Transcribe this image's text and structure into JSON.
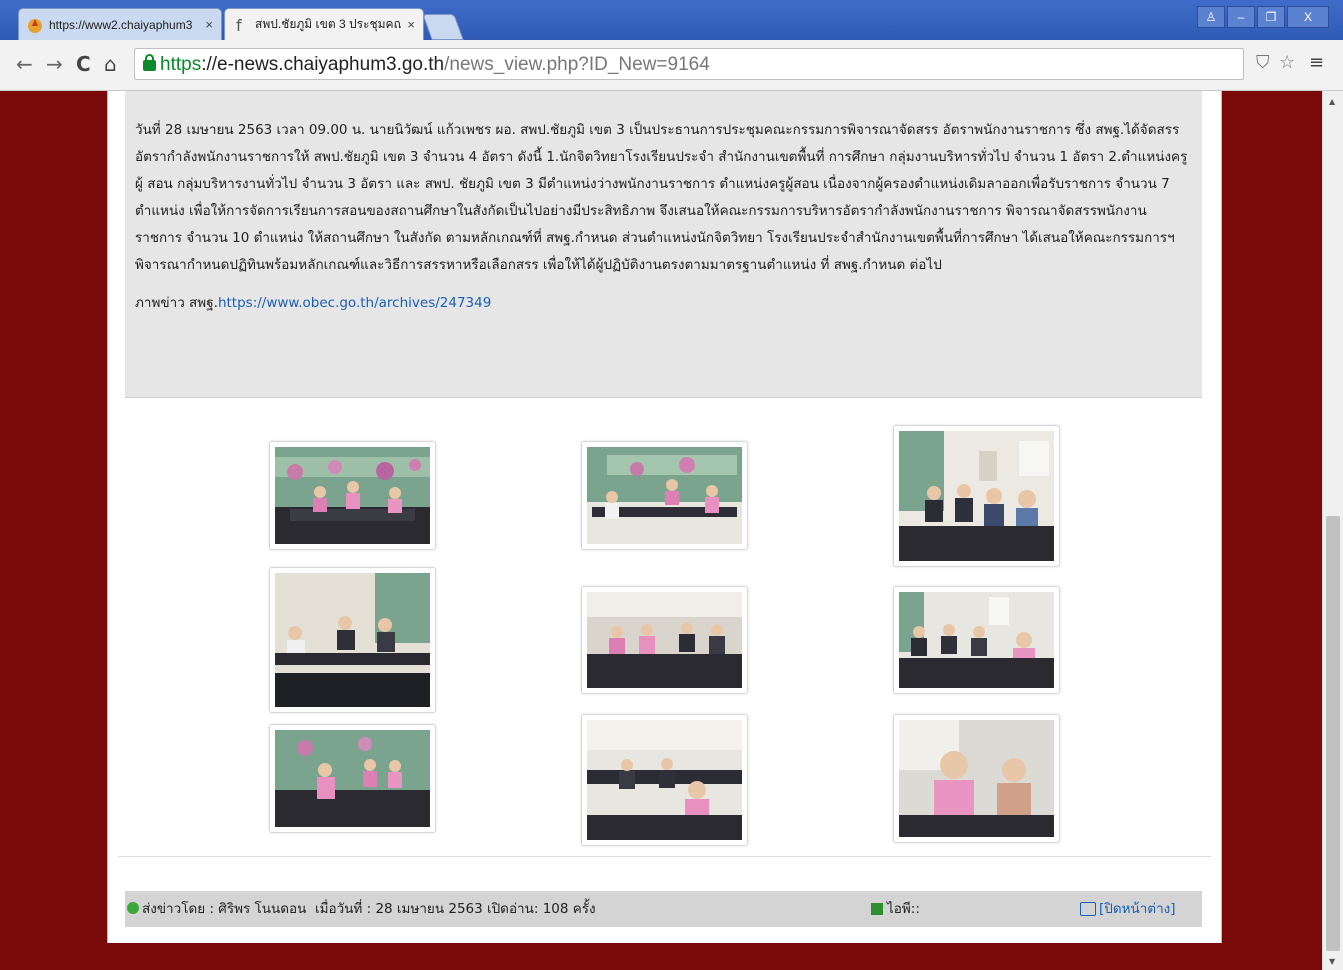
{
  "browser": {
    "tabs": [
      {
        "title": "https://www2.chaiyaphum3",
        "close": "×"
      },
      {
        "title": "สพป.ชัยภูมิ เขต 3 ประชุมคณะ",
        "close": "×"
      }
    ],
    "window_buttons": [
      "♙",
      "–",
      "❐",
      "X"
    ],
    "url_scheme": "https",
    "url_host": "://e-news.chaiyaphum3.go.th",
    "url_path": "/news_view.php?ID_New=9164"
  },
  "article": {
    "body": "วันที่ 28 เมษายน 2563 เวลา 09.00 น. นายนิวัฒน์ แก้วเพชร ผอ. สพป.ชัยภูมิ เขต 3 เป็นประธานการประชุมคณะกรรมการพิจารณาจัดสรร อัตราพนักงานราชการ ซึ่ง สพฐ.ได้จัดสรร อัตรากำลังพนักงานราชการให้ สพป.ชัยภูมิ เขต 3 จำนวน 4 อัตรา ดังนี้ 1.นักจิตวิทยาโรงเรียนประจำ สำนักงานเขตพื้นที่ การศึกษา กลุ่มงานบริหารทั่วไป จำนวน 1 อัตรา 2.ตำแหน่งครูผู้ สอน กลุ่มบริหารงานทั่วไป จำนวน 3 อัตรา และ สพป. ชัยภูมิ เขต 3 มีตำแหน่งว่างพนักงานราชการ ตำแหน่งครูผู้สอน เนื่องจากผู้ครองตำแหน่งเดิมลาออกเพื่อรับราชการ จำนวน 7 ตำแหน่ง เพื่อให้การจัดการเรียนการสอนของสถานศึกษาในสังกัดเป็นไปอย่างมีประสิทธิภาพ จึงเสนอให้คณะกรรมการบริหารอัตรากำลังพนักงานราชการ  พิจารณาจัดสรรพนักงาน ราชการ จำนวน 10 ตำแหน่ง ให้สถานศึกษา ในสังกัด ตามหลักเกณฑ์ที่ สพฐ.กำหนด ส่วนตำแหน่งนักจิตวิทยา โรงเรียนประจำสำนักงานเขตพื้นที่การศึกษา ได้เสนอให้คณะกรรมการฯ พิจารณากำหนดปฏิทินพร้อมหลักเกณฑ์และวิธีการสรรหาหรือเลือกสรร เพื่อให้ได้ผู้ปฏิบัติงานตรงตามมาตรฐานตำแหน่ง ที่ สพฐ.กำหนด ต่อไป",
    "photo_prefix": "ภาพข่าว สพฐ.",
    "photo_link": "https://www.obec.go.th/archives/247349"
  },
  "gallery": {
    "photos": [
      {
        "name": "photo-1",
        "scene": "meeting-mural"
      },
      {
        "name": "photo-2",
        "scene": "meeting-mural"
      },
      {
        "name": "photo-3",
        "scene": "meeting-room"
      },
      {
        "name": "photo-4",
        "scene": "meeting-room"
      },
      {
        "name": "photo-5",
        "scene": "meeting-room"
      },
      {
        "name": "photo-6",
        "scene": "meeting-room"
      },
      {
        "name": "photo-7",
        "scene": "meeting-mural"
      },
      {
        "name": "photo-8",
        "scene": "meeting-room"
      },
      {
        "name": "photo-9",
        "scene": "closeup"
      }
    ]
  },
  "footer": {
    "sender": "ส่งข่าวโดย : ศิริพร โนนดอน",
    "date_reads": "เมื่อวันที่ : 28 เมษายน 2563 เปิดอ่าน: 108 ครั้ง",
    "ip_label": "ไอพี::",
    "close_window": "[ปิดหน้าต่าง]"
  },
  "colors": {
    "page_background": "#7a0a0a",
    "link": "#1a5fb4",
    "url_secure": "#0a8a2a"
  }
}
